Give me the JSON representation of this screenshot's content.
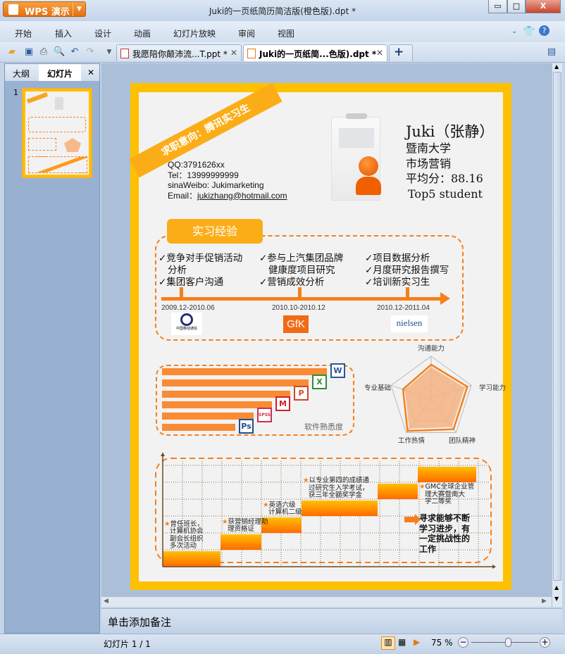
{
  "app": {
    "name": "WPS 演示",
    "title": "Juki的一页纸简历简洁版(橙色版).dpt *"
  },
  "window_controls": {
    "minimize": "▭",
    "maximize": "□",
    "close": "X"
  },
  "menu": [
    "开始",
    "插入",
    "设计",
    "动画",
    "幻灯片放映",
    "审阅",
    "视图"
  ],
  "doc_tabs": [
    {
      "label": "我愿陪你颠沛流...T.ppt *",
      "active": false
    },
    {
      "label": "Juki的一页纸简...色版).dpt *",
      "active": true
    }
  ],
  "new_tab": "+",
  "left_panel": {
    "tabs": [
      "大纲",
      "幻灯片"
    ],
    "close": "✕",
    "slide_number": "1"
  },
  "notes_placeholder": "单击添加备注",
  "status": {
    "slide_info": "幻灯片 1 / 1",
    "zoom": "75 %",
    "zoom_fraction": 0.55
  },
  "slide": {
    "banner": "求职意向：腾讯实习生",
    "contact": {
      "qq": "QQ:3791626xx",
      "tel": "Tel：13999999999",
      "weibo": "sinaWeibo: Jukimarketing",
      "email_label": "Email：",
      "email": "jukizhang@hotmail.com"
    },
    "profile": {
      "name": "Juki（张静）",
      "school": "暨南大学",
      "major": "市场营销",
      "gpa": "平均分：88.16",
      "rank": "Top5 student"
    },
    "experience": {
      "title": "实习经验",
      "items": [
        {
          "lines": [
            "✓竞争对手促销活动",
            "  分析",
            "✓集团客户沟通"
          ],
          "date": "2009.12-2010.06",
          "company": "中国移动通信"
        },
        {
          "lines": [
            "✓参与上汽集团品牌",
            "  健康度项目研究",
            "✓营销成效分析"
          ],
          "date": "2010.10-2010.12",
          "company": "GfK"
        },
        {
          "lines": [
            "✓项目数据分析",
            "✓月度研究报告撰写",
            "✓培训新实习生"
          ],
          "date": "2010.12-2011.04",
          "company": "nielsen"
        }
      ]
    },
    "software": {
      "label": "软件熟悉度",
      "items": [
        {
          "name": "Word",
          "icon": "W",
          "level": 0.9,
          "color": "#2b5797"
        },
        {
          "name": "Excel",
          "icon": "X",
          "level": 0.8,
          "color": "#2f8f2f"
        },
        {
          "name": "PowerPoint",
          "icon": "P",
          "level": 0.7,
          "color": "#d24726"
        },
        {
          "name": "MindManager",
          "icon": "M",
          "level": 0.6,
          "color": "#d0202a"
        },
        {
          "name": "SPSS",
          "icon": "SPSS",
          "level": 0.5,
          "color": "#c8304e"
        },
        {
          "name": "Photoshop",
          "icon": "Ps",
          "level": 0.4,
          "color": "#1f4f8f"
        }
      ]
    },
    "radar": {
      "axes": [
        "沟通能力",
        "学习能力",
        "团队精神",
        "工作热情",
        "专业基础"
      ],
      "values": [
        0.8,
        0.9,
        0.9,
        0.95,
        0.7
      ]
    },
    "achievements": [
      {
        "text": [
          "★曾任班长，",
          "计算机协会",
          "副会长组织",
          "多次活动"
        ]
      },
      {
        "text": [
          "★获营销经理助",
          "理资格证"
        ]
      },
      {
        "text": [
          "★英语六级",
          "计算机二级"
        ]
      },
      {
        "text": [
          "★以专业第四的成绩通",
          "过研究生入学考试，",
          "获三年全额奖学金"
        ]
      },
      {
        "text": []
      },
      {
        "text": [
          "★GMC全球企业管",
          "理大赛暨南大",
          "学二等奖"
        ]
      }
    ],
    "goal": [
      "寻求能够不断",
      "学习进步，有",
      "一定挑战性的",
      "工作"
    ]
  }
}
